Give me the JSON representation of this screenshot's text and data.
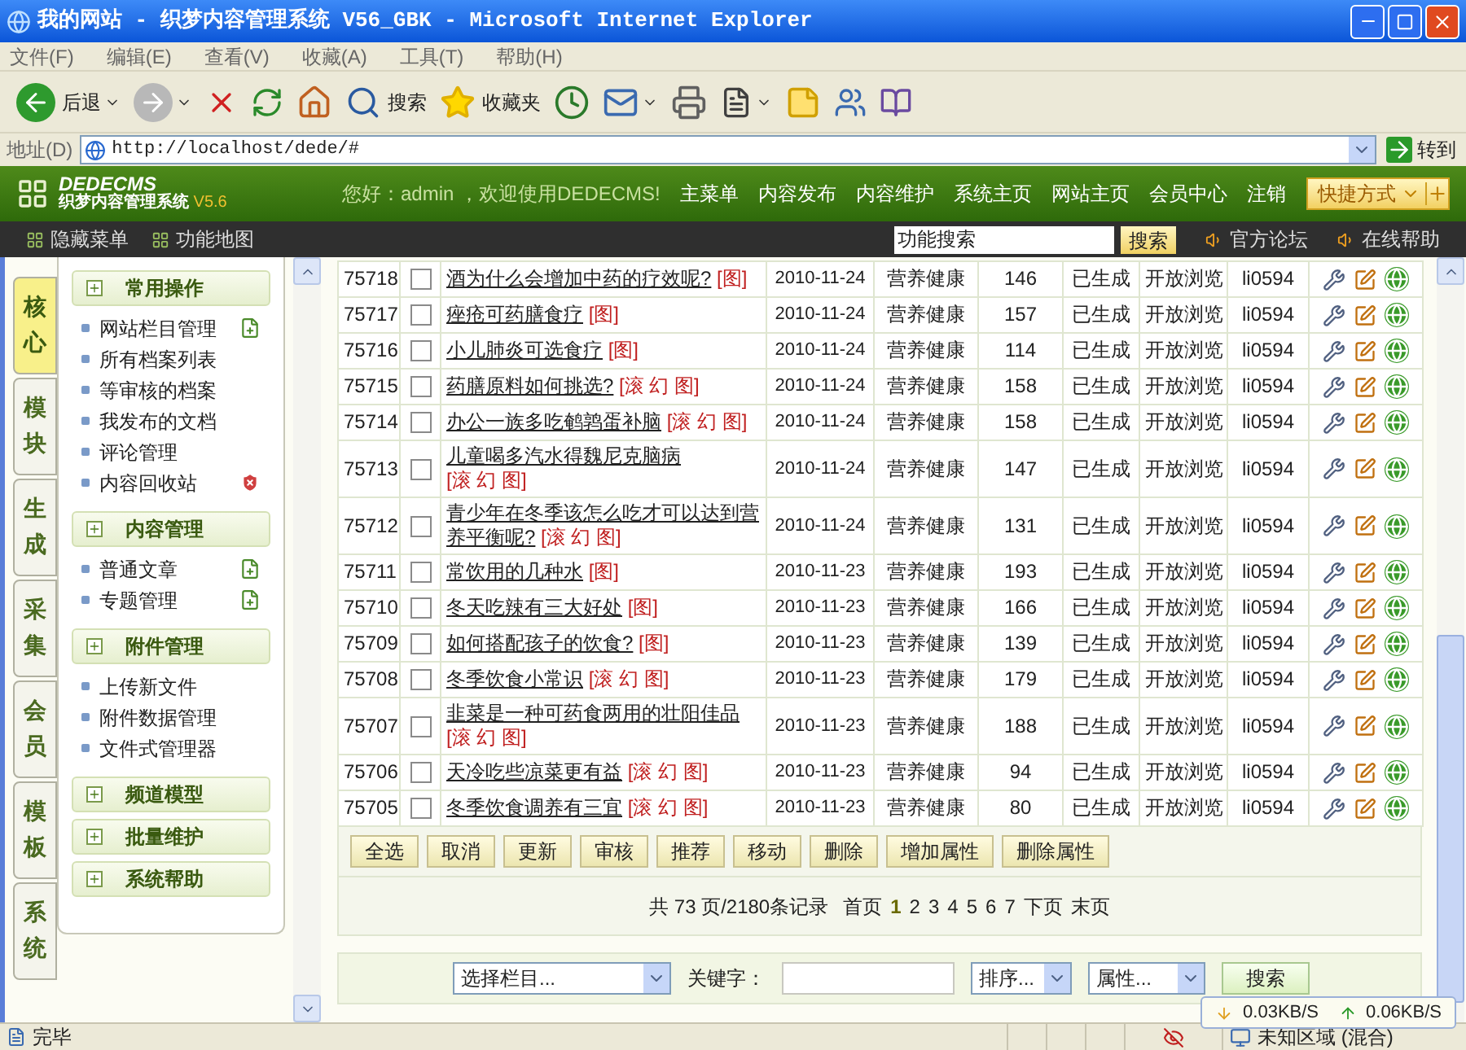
{
  "window": {
    "title": "我的网站 - 织梦内容管理系统 V56_GBK - Microsoft Internet Explorer"
  },
  "menu": [
    "文件(F)",
    "编辑(E)",
    "查看(V)",
    "收藏(A)",
    "工具(T)",
    "帮助(H)"
  ],
  "toolbar": [
    {
      "kind": "back",
      "label": "后退",
      "dropdown": true
    },
    {
      "kind": "forward",
      "dropdown": true
    },
    {
      "kind": "stop",
      "dropdown": false
    },
    {
      "kind": "refresh",
      "dropdown": false
    },
    {
      "kind": "home",
      "dropdown": false
    },
    {
      "kind": "search",
      "label": "搜索",
      "dropdown": false
    },
    {
      "kind": "favorites",
      "label": "收藏夹",
      "dropdown": false
    },
    {
      "kind": "history",
      "dropdown": false
    },
    {
      "kind": "mail",
      "dropdown": true
    },
    {
      "kind": "print",
      "dropdown": false
    },
    {
      "kind": "edit",
      "dropdown": true
    },
    {
      "kind": "note",
      "dropdown": false
    },
    {
      "kind": "messenger",
      "dropdown": false
    },
    {
      "kind": "research",
      "dropdown": false
    }
  ],
  "address": {
    "label": "地址(D)",
    "value": "http://localhost/dede/#",
    "go": "转到"
  },
  "header": {
    "logo": "DEDECMS",
    "subtitle": "织梦内容管理系统",
    "version": "V5.6",
    "greeting": "您好：admin ，欢迎使用DEDECMS!",
    "nav": [
      "主菜单",
      "内容发布",
      "内容维护",
      "系统主页",
      "网站主页",
      "会员中心",
      "注销"
    ],
    "shortcut": "快捷方式"
  },
  "subbar": {
    "links": [
      "隐藏菜单",
      "功能地图"
    ],
    "search_value": "功能搜索",
    "search_button": "搜索",
    "help_links": [
      "官方论坛",
      "在线帮助"
    ]
  },
  "side_tabs": [
    {
      "label": "核心",
      "selected": true
    },
    {
      "label": "模块",
      "selected": false
    },
    {
      "label": "生成",
      "selected": false
    },
    {
      "label": "采集",
      "selected": false
    },
    {
      "label": "会员",
      "selected": false
    },
    {
      "label": "模板",
      "selected": false
    },
    {
      "label": "系统",
      "selected": false
    }
  ],
  "sidebar": [
    {
      "title": "常用操作",
      "items": [
        {
          "label": "网站栏目管理",
          "kind": "add"
        },
        {
          "label": "所有档案列表",
          "kind": "plain"
        },
        {
          "label": "等审核的档案",
          "kind": "plain"
        },
        {
          "label": "我发布的文档",
          "kind": "plain"
        },
        {
          "label": "评论管理",
          "kind": "plain"
        },
        {
          "label": "内容回收站",
          "kind": "remove"
        }
      ]
    },
    {
      "title": "内容管理",
      "items": [
        {
          "label": "普通文章",
          "kind": "add"
        },
        {
          "label": "专题管理",
          "kind": "add"
        }
      ]
    },
    {
      "title": "附件管理",
      "items": [
        {
          "label": "上传新文件",
          "kind": "plain"
        },
        {
          "label": "附件数据管理",
          "kind": "plain"
        },
        {
          "label": "文件式管理器",
          "kind": "plain"
        }
      ]
    },
    {
      "title": "频道模型"
    },
    {
      "title": "批量维护"
    },
    {
      "title": "系统帮助"
    }
  ],
  "table": {
    "rows": [
      {
        "id": "75718",
        "checked": false,
        "title": "酒为什么会增加中药的疗效呢?",
        "tag": "[图]",
        "date": "2010-11-24",
        "category": "营养健康",
        "clicks": "146",
        "status": "已生成",
        "access": "开放浏览",
        "author": "li0594"
      },
      {
        "id": "75717",
        "checked": false,
        "title": "痤疮可药膳食疗",
        "tag": "[图]",
        "date": "2010-11-24",
        "category": "营养健康",
        "clicks": "157",
        "status": "已生成",
        "access": "开放浏览",
        "author": "li0594"
      },
      {
        "id": "75716",
        "checked": false,
        "title": "小儿肺炎可选食疗",
        "tag": "[图]",
        "date": "2010-11-24",
        "category": "营养健康",
        "clicks": "114",
        "status": "已生成",
        "access": "开放浏览",
        "author": "li0594"
      },
      {
        "id": "75715",
        "checked": false,
        "title": "药膳原料如何挑选?",
        "tag": "[滚 幻 图]",
        "date": "2010-11-24",
        "category": "营养健康",
        "clicks": "158",
        "status": "已生成",
        "access": "开放浏览",
        "author": "li0594"
      },
      {
        "id": "75714",
        "checked": false,
        "title": "办公一族多吃鹌鹑蛋补脑",
        "tag": "[滚 幻 图]",
        "date": "2010-11-24",
        "category": "营养健康",
        "clicks": "158",
        "status": "已生成",
        "access": "开放浏览",
        "author": "li0594"
      },
      {
        "id": "75713",
        "checked": false,
        "title": "儿童喝多汽水得魏尼克脑病",
        "tag": "[滚 幻 图]",
        "date": "2010-11-24",
        "category": "营养健康",
        "clicks": "147",
        "status": "已生成",
        "access": "开放浏览",
        "author": "li0594"
      },
      {
        "id": "75712",
        "checked": false,
        "title": "青少年在冬季该怎么吃才可以达到营养平衡呢?",
        "tag": "[滚 幻 图]",
        "date": "2010-11-24",
        "category": "营养健康",
        "clicks": "131",
        "status": "已生成",
        "access": "开放浏览",
        "author": "li0594"
      },
      {
        "id": "75711",
        "checked": false,
        "title": "常饮用的几种水",
        "tag": "[图]",
        "date": "2010-11-23",
        "category": "营养健康",
        "clicks": "193",
        "status": "已生成",
        "access": "开放浏览",
        "author": "li0594"
      },
      {
        "id": "75710",
        "checked": false,
        "title": "冬天吃辣有三大好处",
        "tag": "[图]",
        "date": "2010-11-23",
        "category": "营养健康",
        "clicks": "166",
        "status": "已生成",
        "access": "开放浏览",
        "author": "li0594"
      },
      {
        "id": "75709",
        "checked": false,
        "title": "如何搭配孩子的饮食?",
        "tag": "[图]",
        "date": "2010-11-23",
        "category": "营养健康",
        "clicks": "139",
        "status": "已生成",
        "access": "开放浏览",
        "author": "li0594"
      },
      {
        "id": "75708",
        "checked": false,
        "title": "冬季饮食小常识",
        "tag": "[滚 幻 图]",
        "date": "2010-11-23",
        "category": "营养健康",
        "clicks": "179",
        "status": "已生成",
        "access": "开放浏览",
        "author": "li0594"
      },
      {
        "id": "75707",
        "checked": false,
        "title": "韭菜是一种可药食两用的壮阳佳品",
        "tag": "[滚 幻 图]",
        "date": "2010-11-23",
        "category": "营养健康",
        "clicks": "188",
        "status": "已生成",
        "access": "开放浏览",
        "author": "li0594"
      },
      {
        "id": "75706",
        "checked": false,
        "title": "天冷吃些凉菜更有益",
        "tag": "[滚 幻 图]",
        "date": "2010-11-23",
        "category": "营养健康",
        "clicks": "94",
        "status": "已生成",
        "access": "开放浏览",
        "author": "li0594"
      },
      {
        "id": "75705",
        "checked": false,
        "title": "冬季饮食调养有三宜",
        "tag": "[滚 幻 图]",
        "date": "2010-11-23",
        "category": "营养健康",
        "clicks": "80",
        "status": "已生成",
        "access": "开放浏览",
        "author": "li0594"
      }
    ]
  },
  "actions": [
    "全选",
    "取消",
    "更新",
    "审核",
    "推荐",
    "移动",
    "删除",
    "增加属性",
    "删除属性"
  ],
  "pagination": {
    "summary": "共 73 页/2180条记录",
    "first": "首页",
    "pages": [
      {
        "label": "1",
        "selected": true
      },
      {
        "label": "2",
        "selected": false
      },
      {
        "label": "3",
        "selected": false
      },
      {
        "label": "4",
        "selected": false
      },
      {
        "label": "5",
        "selected": false
      },
      {
        "label": "6",
        "selected": false
      },
      {
        "label": "7",
        "selected": false
      }
    ],
    "next": "下页",
    "last": "末页"
  },
  "search": {
    "category": "选择栏目...",
    "keyword_label": "关键字：",
    "order": "排序...",
    "attribute": "属性...",
    "button": "搜索"
  },
  "status_bar": {
    "text": "完毕",
    "zone": "未知区域 (混合)"
  },
  "net_speed": {
    "down": "0.03KB/S",
    "up": "0.06KB/S"
  }
}
